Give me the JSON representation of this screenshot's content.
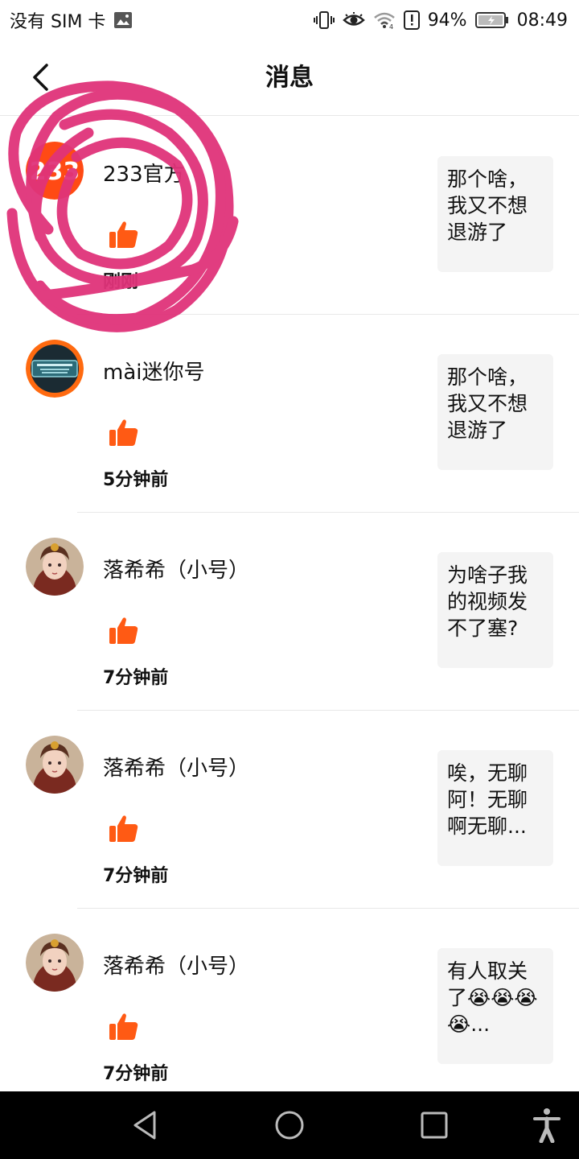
{
  "status_bar": {
    "carrier": "没有 SIM 卡",
    "battery": "94%",
    "time": "08:49",
    "icons": [
      "image-icon",
      "vibrate-icon",
      "eye-icon",
      "wifi-icon",
      "alert-icon",
      "battery-icon"
    ]
  },
  "header": {
    "title": "消息",
    "back_icon": "chevron-left-icon"
  },
  "messages": [
    {
      "username": "233官方",
      "time": "刚刚",
      "preview": "那个啥，我又不想退游了",
      "avatar": "233-logo"
    },
    {
      "username": "mài迷你号",
      "time": "5分钟前",
      "preview": "那个啥，我又不想退游了",
      "avatar": "game-badge"
    },
    {
      "username": "落希希（小号）",
      "time": "7分钟前",
      "preview": "为啥子我的视频发不了塞?",
      "avatar": "anime-girl"
    },
    {
      "username": "落希希（小号）",
      "time": "7分钟前",
      "preview": "唉，无聊阿！无聊啊无聊...",
      "avatar": "anime-girl"
    },
    {
      "username": "落希希（小号）",
      "time": "7分钟前",
      "preview": "有人取关了😭😭😭😭...",
      "avatar": "anime-girl"
    }
  ],
  "colors": {
    "like": "#ff5a14",
    "scribble": "#e0337a",
    "nav_bg": "#000000",
    "preview_bg": "#f4f4f4"
  },
  "nav_bar": {
    "icons": [
      "back-triangle-icon",
      "home-circle-icon",
      "recents-square-icon",
      "accessibility-icon"
    ]
  }
}
